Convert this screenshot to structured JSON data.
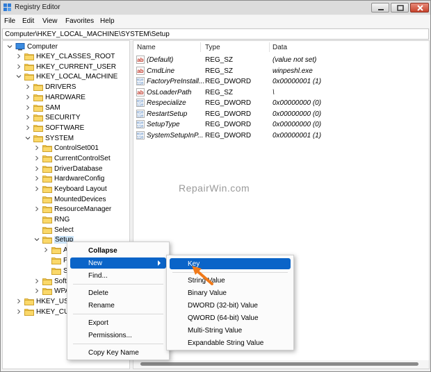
{
  "window": {
    "title": "Registry Editor"
  },
  "menubar": {
    "items": [
      "File",
      "Edit",
      "View",
      "Favorites",
      "Help"
    ]
  },
  "address": {
    "path": "Computer\\HKEY_LOCAL_MACHINE\\SYSTEM\\Setup"
  },
  "tree": {
    "computer": "Computer",
    "hkcr": "HKEY_CLASSES_ROOT",
    "hkcu": "HKEY_CURRENT_USER",
    "hklm": "HKEY_LOCAL_MACHINE",
    "drivers": "DRIVERS",
    "hardware": "HARDWARE",
    "sam": "SAM",
    "security": "SECURITY",
    "software": "SOFTWARE",
    "system": "SYSTEM",
    "controlset001": "ControlSet001",
    "currentcontrolset": "CurrentControlSet",
    "driverdatabase": "DriverDatabase",
    "hardwareconfig": "HardwareConfig",
    "keyboardlayout": "Keyboard Layout",
    "mounteddevices": "MountedDevices",
    "resourcemanager": "ResourceManager",
    "rng": "RNG",
    "select": "Select",
    "setup": "Setup",
    "setup_child1": "A",
    "setup_child2": "P",
    "setup_child3": "S",
    "softw_trunc": "Softw",
    "wpa_trunc": "WPA",
    "hku_trunc": "HKEY_USEI",
    "hkcc_trunc": "HKEY_CUR"
  },
  "list": {
    "headers": {
      "name": "Name",
      "type": "Type",
      "data": "Data"
    },
    "rows": [
      {
        "name": "(Default)",
        "type": "REG_SZ",
        "data": "(value not set)",
        "icon": "string-value-icon"
      },
      {
        "name": "CmdLine",
        "type": "REG_SZ",
        "data": "winpeshl.exe",
        "icon": "string-value-icon"
      },
      {
        "name": "FactoryPreInstall...",
        "type": "REG_DWORD",
        "data": "0x00000001 (1)",
        "icon": "binary-value-icon"
      },
      {
        "name": "OsLoaderPath",
        "type": "REG_SZ",
        "data": "\\",
        "icon": "string-value-icon"
      },
      {
        "name": "Respecialize",
        "type": "REG_DWORD",
        "data": "0x00000000 (0)",
        "icon": "binary-value-icon"
      },
      {
        "name": "RestartSetup",
        "type": "REG_DWORD",
        "data": "0x00000000 (0)",
        "icon": "binary-value-icon"
      },
      {
        "name": "SetupType",
        "type": "REG_DWORD",
        "data": "0x00000000 (0)",
        "icon": "binary-value-icon"
      },
      {
        "name": "SystemSetupInP...",
        "type": "REG_DWORD",
        "data": "0x00000001 (1)",
        "icon": "binary-value-icon"
      }
    ]
  },
  "watermark": "RepairWin.com",
  "context_menu": {
    "collapse": "Collapse",
    "new": "New",
    "find": "Find...",
    "delete": "Delete",
    "rename": "Rename",
    "export": "Export",
    "permissions": "Permissions...",
    "copy_key_name": "Copy Key Name"
  },
  "submenu": {
    "key": "Key",
    "string_value": "String Value",
    "binary_value": "Binary Value",
    "dword_value": "DWORD (32-bit) Value",
    "qword_value": "QWORD (64-bit) Value",
    "multi_string_value": "Multi-String Value",
    "expandable_string_value": "Expandable String Value"
  },
  "colors": {
    "accent": "#0a64c8",
    "folder": "#f2c94c",
    "arrow": "#f07a1a",
    "selection": "#cce4f7"
  }
}
